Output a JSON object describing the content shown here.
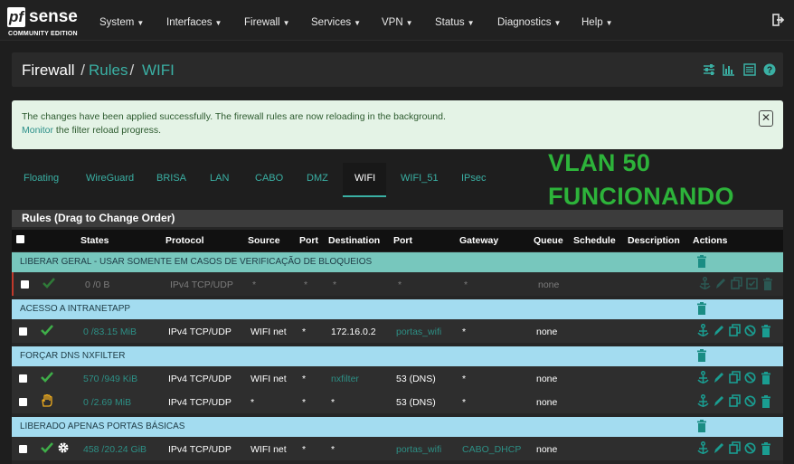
{
  "app": {
    "logo_pf": "pf",
    "logo_sense": "sense",
    "logo_edition": "COMMUNITY EDITION"
  },
  "nav": {
    "items": [
      {
        "label": "System"
      },
      {
        "label": "Interfaces"
      },
      {
        "label": "Firewall"
      },
      {
        "label": "Services"
      },
      {
        "label": "VPN"
      },
      {
        "label": "Status"
      },
      {
        "label": "Diagnostics"
      },
      {
        "label": "Help"
      }
    ]
  },
  "breadcrumb": {
    "part1": "Firewall",
    "part2": "Rules",
    "part3": "WIFI"
  },
  "alert": {
    "message": "The changes have been applied successfully. The firewall rules are now reloading in the background.",
    "link_text": "Monitor",
    "link_suffix": " the filter reload progress."
  },
  "tabs": [
    {
      "label": "Floating"
    },
    {
      "label": "WireGuard"
    },
    {
      "label": "BRISA"
    },
    {
      "label": "LAN"
    },
    {
      "label": "CABO"
    },
    {
      "label": "DMZ"
    },
    {
      "label": "WIFI",
      "active": true
    },
    {
      "label": "WIFI_51"
    },
    {
      "label": "IPsec"
    }
  ],
  "annotation": {
    "line1": "VLAN 50",
    "line2": "FUNCIONANDO"
  },
  "panel": {
    "title": "Rules (Drag to Change Order)"
  },
  "table": {
    "headers": {
      "states": "States",
      "protocol": "Protocol",
      "source": "Source",
      "source_port": "Port",
      "destination": "Destination",
      "dest_port": "Port",
      "gateway": "Gateway",
      "queue": "Queue",
      "schedule": "Schedule",
      "description": "Description",
      "actions": "Actions"
    },
    "separators": [
      {
        "label": "LIBERAR GERAL - USAR SOMENTE EM CASOS DE VERIFICAÇÃO DE BLOQUEIOS",
        "color": "#77c7bd"
      },
      {
        "label": "ACESSO A INTRANETAPP",
        "color": "#a3dcf0"
      },
      {
        "label": "FORÇAR DNS NXFILTER",
        "color": "#a3dcf0"
      },
      {
        "label": "LIBERADO APENAS PORTAS BÁSICAS",
        "color": "#a3dcf0"
      }
    ],
    "rows": [
      {
        "status": "pass-icon",
        "states": "0 /0 B",
        "protocol": "IPv4 TCP/UDP",
        "source": "*",
        "source_port": "*",
        "destination": "*",
        "dest_port": "*",
        "gateway": "*",
        "queue": "none",
        "disabled": true
      },
      {
        "status": "pass-icon",
        "states": "0 /83.15 MiB",
        "protocol": "IPv4 TCP/UDP",
        "source": "WIFI net",
        "source_port": "*",
        "destination": "172.16.0.2",
        "dest_port": "portas_wifi",
        "gateway": "*",
        "queue": "none"
      },
      {
        "status": "pass-icon",
        "states": "570 /949 KiB",
        "protocol": "IPv4 TCP/UDP",
        "source": "WIFI net",
        "source_port": "*",
        "destination": "nxfilter",
        "dest_port": "53 (DNS)",
        "gateway": "*",
        "queue": "none"
      },
      {
        "status": "hand-icon",
        "states": "0 /2.69 MiB",
        "protocol": "IPv4 TCP/UDP",
        "source": "*",
        "source_port": "*",
        "destination": "*",
        "dest_port": "53 (DNS)",
        "gateway": "*",
        "queue": "none"
      },
      {
        "status": "pass-icon",
        "states": "458 /20.24 GiB",
        "protocol": "IPv4 TCP/UDP",
        "source": "WIFI net",
        "source_port": "*",
        "destination": "*",
        "dest_port": "portas_wifi",
        "gateway": "CABO_DHCP",
        "queue": "none"
      }
    ]
  },
  "colors": {
    "accent": "#3ab0a4",
    "pass": "#3fae49",
    "hand": "#f0ad1e",
    "annotation": "#2db33a"
  }
}
